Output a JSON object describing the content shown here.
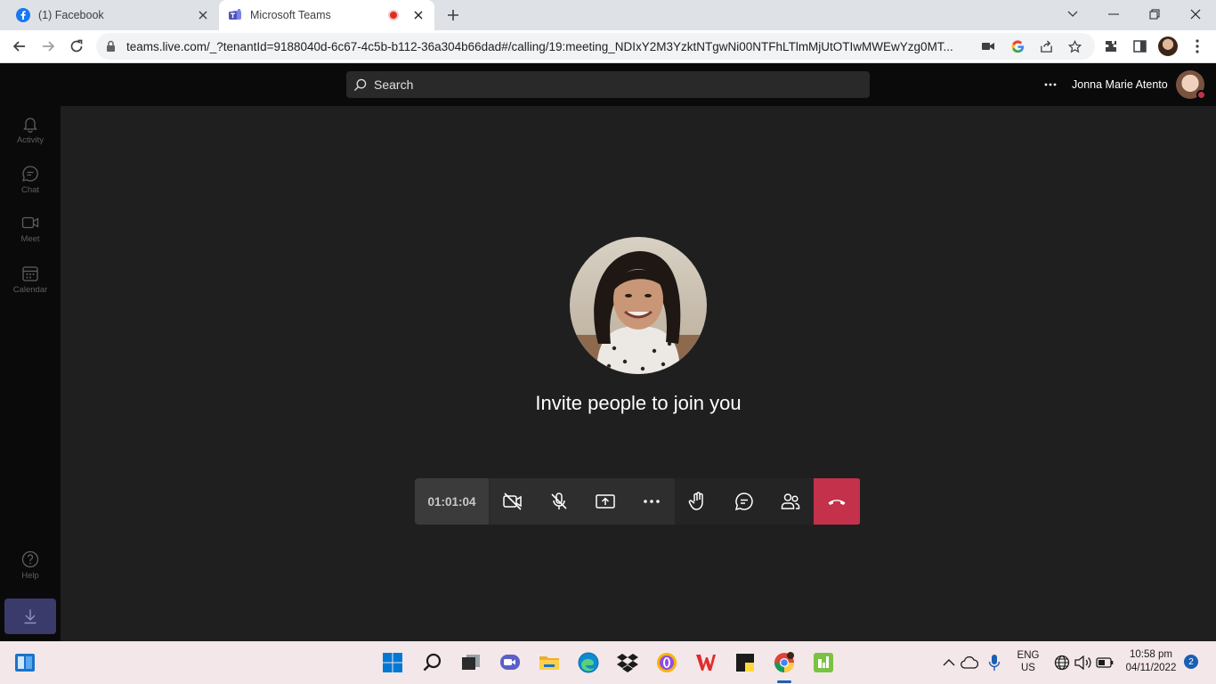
{
  "browser": {
    "tabs": [
      {
        "label": "(1) Facebook",
        "favicon": "facebook-icon"
      },
      {
        "label": "Microsoft Teams",
        "favicon": "teams-icon",
        "recording": true
      }
    ],
    "url": "teams.live.com/_?tenantId=9188040d-6c67-4c5b-b112-36a304b66dad#/calling/19:meeting_NDIxY2M3YzktNTgwNi00NTFhLTlmMjUtOTIwMWEwYzg0MT..."
  },
  "teams": {
    "search_placeholder": "Search",
    "user_name": "Jonna Marie Atento",
    "rail": [
      {
        "label": "Activity",
        "icon": "bell-icon"
      },
      {
        "label": "Chat",
        "icon": "chat-icon"
      },
      {
        "label": "Meet",
        "icon": "video-icon"
      },
      {
        "label": "Calendar",
        "icon": "calendar-icon"
      }
    ],
    "help_label": "Help",
    "invite_text": "Invite people to join you",
    "call_timer": "01:01:04",
    "call_controls": [
      "camera-off-icon",
      "mic-off-icon",
      "share-screen-icon",
      "more-icon",
      "raise-hand-icon",
      "chat-icon",
      "participants-icon",
      "hang-up-icon"
    ]
  },
  "taskbar": {
    "lang_line1": "ENG",
    "lang_line2": "US",
    "time": "10:58 pm",
    "date": "04/11/2022",
    "notification_count": "2"
  },
  "colors": {
    "accent_hangup": "#c4314b",
    "teams_bg": "#1f1f1f",
    "rail_bg": "#0a0a0a"
  }
}
